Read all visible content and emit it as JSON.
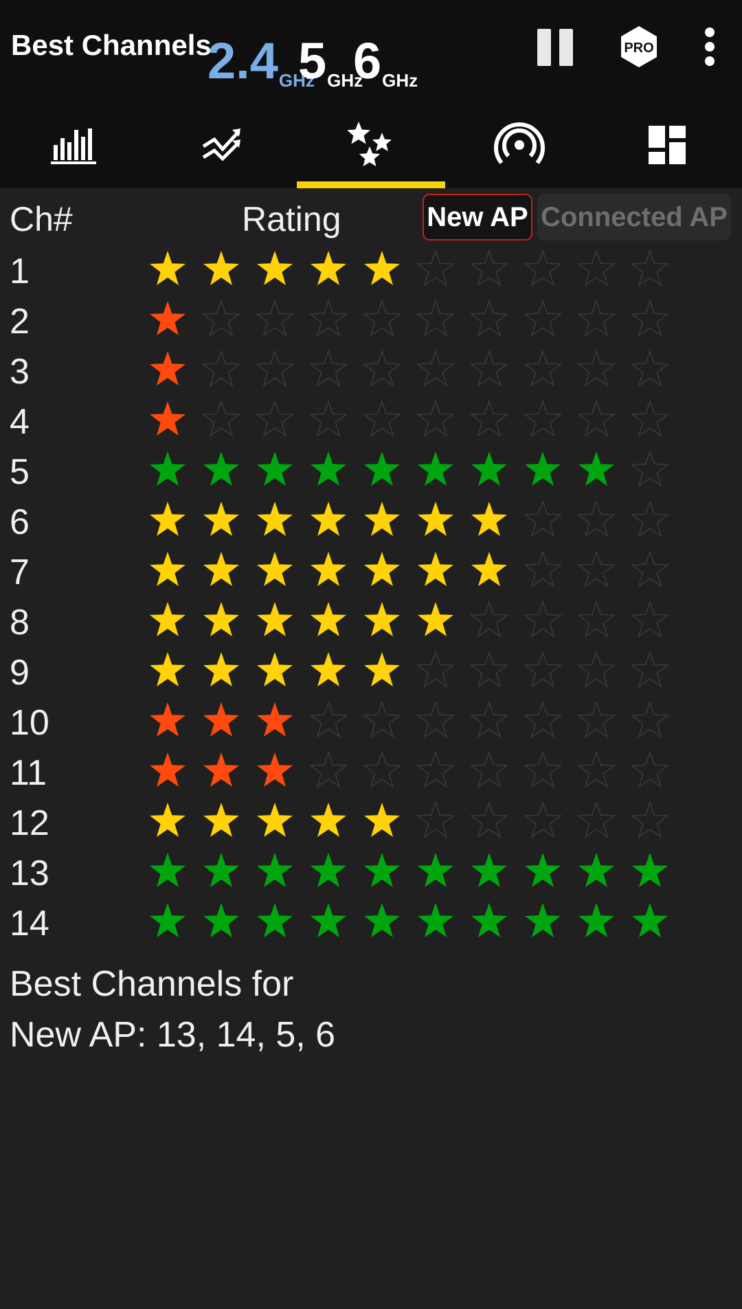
{
  "header": {
    "title": "Best Channels",
    "bands": [
      {
        "value": "2.4",
        "unit": "GHz",
        "active": true
      },
      {
        "value": "5",
        "unit": "GHz",
        "active": false
      },
      {
        "value": "6",
        "unit": "GHz",
        "active": false
      }
    ],
    "pro_label": "PRO",
    "icons": [
      "pause-icon",
      "pro-icon",
      "more-options-icon"
    ]
  },
  "tabs": [
    {
      "icon": "bar-graph-icon",
      "selected": false
    },
    {
      "icon": "time-graph-icon",
      "selected": false
    },
    {
      "icon": "channel-rating-icon",
      "selected": true
    },
    {
      "icon": "access-points-icon",
      "selected": false
    },
    {
      "icon": "dashboard-icon",
      "selected": false
    }
  ],
  "table": {
    "col_channel": "Ch#",
    "col_rating": "Rating",
    "toggle_new_ap": "New AP",
    "toggle_connected_ap": "Connected AP",
    "max_stars": 10,
    "colors": {
      "red": "#ff4a0f",
      "yellow": "#ffd20a",
      "green": "#00a60e",
      "empty_outline": "#3a3a3a"
    },
    "rows": [
      {
        "ch": "1",
        "stars": 5,
        "color": "yellow"
      },
      {
        "ch": "2",
        "stars": 1,
        "color": "red"
      },
      {
        "ch": "3",
        "stars": 1,
        "color": "red"
      },
      {
        "ch": "4",
        "stars": 1,
        "color": "red"
      },
      {
        "ch": "5",
        "stars": 9,
        "color": "green"
      },
      {
        "ch": "6",
        "stars": 7,
        "color": "yellow"
      },
      {
        "ch": "7",
        "stars": 7,
        "color": "yellow"
      },
      {
        "ch": "8",
        "stars": 6,
        "color": "yellow"
      },
      {
        "ch": "9",
        "stars": 5,
        "color": "yellow"
      },
      {
        "ch": "10",
        "stars": 3,
        "color": "red"
      },
      {
        "ch": "11",
        "stars": 3,
        "color": "red"
      },
      {
        "ch": "12",
        "stars": 5,
        "color": "yellow"
      },
      {
        "ch": "13",
        "stars": 10,
        "color": "green"
      },
      {
        "ch": "14",
        "stars": 10,
        "color": "green"
      }
    ]
  },
  "summary": {
    "line1": "Best Channels for",
    "line2": "New AP: 13, 14, 5, 6"
  },
  "accent": "#f5d20a",
  "active_band_color": "#7aaee6"
}
